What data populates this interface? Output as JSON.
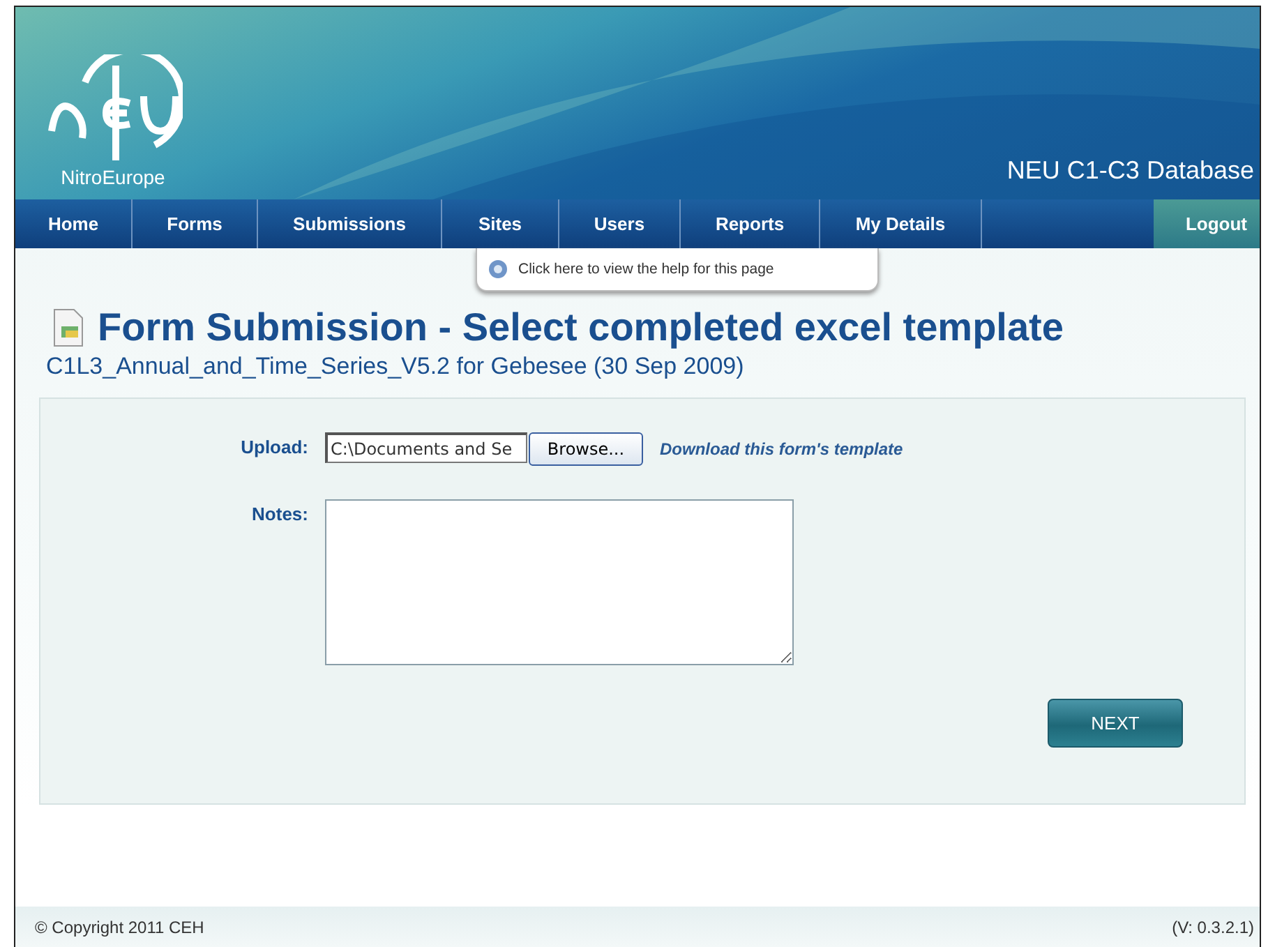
{
  "header": {
    "logo_text": "NitroEurope",
    "site_title": "NEU C1-C3 Database"
  },
  "nav": {
    "items": [
      {
        "label": "Home",
        "selected": false
      },
      {
        "label": "Forms",
        "selected": false
      },
      {
        "label": "Submissions",
        "selected": false
      },
      {
        "label": "Sites",
        "selected": false
      },
      {
        "label": "Users",
        "selected": false
      },
      {
        "label": "Reports",
        "selected": false
      },
      {
        "label": "My Details",
        "selected": false
      }
    ],
    "logout": "Logout"
  },
  "help_tab": "Click here to view the help for this page",
  "page": {
    "title": "Form Submission - Select completed excel template",
    "subtitle": "C1L3_Annual_and_Time_Series_V5.2 for Gebesee (30 Sep 2009)"
  },
  "form": {
    "upload_label": "Upload:",
    "upload_value": "C:\\Documents and Se",
    "browse": "Browse...",
    "template_link": "Download this form's template",
    "notes_label": "Notes:",
    "next": "NEXT"
  },
  "footer": {
    "copyright": "© Copyright 2011 CEH",
    "version": "(V: 0.3.2.1)"
  }
}
